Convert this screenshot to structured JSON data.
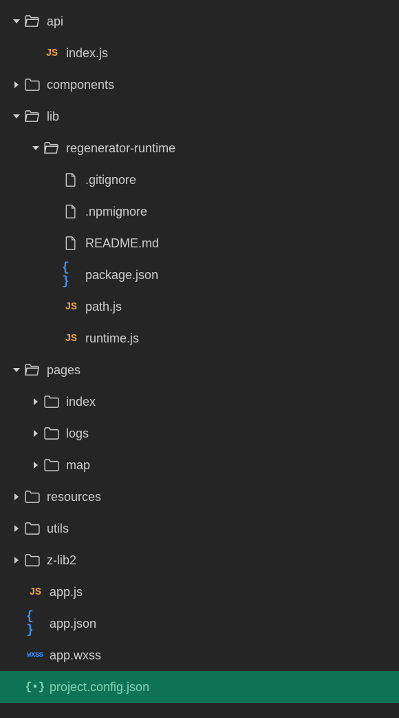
{
  "tree": [
    {
      "id": "api",
      "label": "api",
      "depth": 0,
      "expanded": true,
      "type": "folder-open"
    },
    {
      "id": "api-index",
      "label": "index.js",
      "depth": 1,
      "expanded": null,
      "type": "js"
    },
    {
      "id": "components",
      "label": "components",
      "depth": 0,
      "expanded": false,
      "type": "folder"
    },
    {
      "id": "lib",
      "label": "lib",
      "depth": 0,
      "expanded": true,
      "type": "folder-open"
    },
    {
      "id": "regen",
      "label": "regenerator-runtime",
      "depth": 1,
      "expanded": true,
      "type": "folder-open"
    },
    {
      "id": "gitignore",
      "label": ".gitignore",
      "depth": 2,
      "expanded": null,
      "type": "file"
    },
    {
      "id": "npmignore",
      "label": ".npmignore",
      "depth": 2,
      "expanded": null,
      "type": "file"
    },
    {
      "id": "readme",
      "label": "README.md",
      "depth": 2,
      "expanded": null,
      "type": "file"
    },
    {
      "id": "package",
      "label": "package.json",
      "depth": 2,
      "expanded": null,
      "type": "json"
    },
    {
      "id": "pathjs",
      "label": "path.js",
      "depth": 2,
      "expanded": null,
      "type": "js"
    },
    {
      "id": "runtimejs",
      "label": "runtime.js",
      "depth": 2,
      "expanded": null,
      "type": "js"
    },
    {
      "id": "pages",
      "label": "pages",
      "depth": 0,
      "expanded": true,
      "type": "folder-open"
    },
    {
      "id": "pages-index",
      "label": "index",
      "depth": 1,
      "expanded": false,
      "type": "folder"
    },
    {
      "id": "pages-logs",
      "label": "logs",
      "depth": 1,
      "expanded": false,
      "type": "folder"
    },
    {
      "id": "pages-map",
      "label": "map",
      "depth": 1,
      "expanded": false,
      "type": "folder"
    },
    {
      "id": "resources",
      "label": "resources",
      "depth": 0,
      "expanded": false,
      "type": "folder"
    },
    {
      "id": "utils",
      "label": "utils",
      "depth": 0,
      "expanded": false,
      "type": "folder"
    },
    {
      "id": "zlib2",
      "label": "z-lib2",
      "depth": 0,
      "expanded": false,
      "type": "folder"
    },
    {
      "id": "appjs",
      "label": "app.js",
      "depth": 0,
      "expanded": null,
      "type": "js",
      "noChevron": true
    },
    {
      "id": "appjson",
      "label": "app.json",
      "depth": 0,
      "expanded": null,
      "type": "json",
      "noChevron": true
    },
    {
      "id": "appwxss",
      "label": "app.wxss",
      "depth": 0,
      "expanded": null,
      "type": "wxss",
      "noChevron": true
    },
    {
      "id": "projectconfig",
      "label": "project.config.json",
      "depth": 0,
      "expanded": null,
      "type": "json-green",
      "noChevron": true,
      "selected": true
    }
  ],
  "icons": {
    "js": "JS",
    "wxss": "WXSS"
  }
}
